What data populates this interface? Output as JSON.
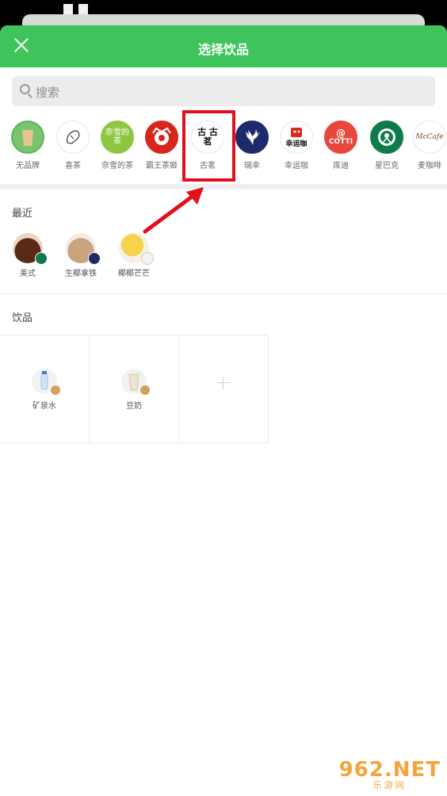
{
  "header": {
    "title": "选择饮品"
  },
  "search": {
    "placeholder": "搜索"
  },
  "brands": [
    {
      "label": "无品牌",
      "logo_text": ""
    },
    {
      "label": "喜茶",
      "logo_text": ""
    },
    {
      "label": "奈雪的茶",
      "logo_text": "奈雪的茶"
    },
    {
      "label": "霸王茶姬",
      "logo_text": ""
    },
    {
      "label": "古茗",
      "logo_text": "古 古茗"
    },
    {
      "label": "瑞幸",
      "logo_text": ""
    },
    {
      "label": "幸运咖",
      "logo_text": "幸运咖"
    },
    {
      "label": "库迪",
      "logo_text": "COTTI"
    },
    {
      "label": "星巴克",
      "logo_text": ""
    },
    {
      "label": "麦咖啡",
      "logo_text": "McCafe"
    }
  ],
  "recent": {
    "title": "最近",
    "items": [
      {
        "label": "美式"
      },
      {
        "label": "生椰拿铁"
      },
      {
        "label": "椰椰芒芒"
      }
    ]
  },
  "drinks": {
    "title": "饮品",
    "items": [
      {
        "label": "矿泉水"
      },
      {
        "label": "豆奶"
      }
    ]
  },
  "watermark": {
    "big": "962.NET",
    "small": "乐游网"
  },
  "colors": {
    "accent": "#3ec45a",
    "highlight": "#e1101a"
  }
}
